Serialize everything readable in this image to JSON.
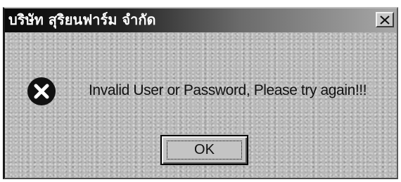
{
  "dialog": {
    "title": "บริษัท สุริยนฟาร์ม จำกัด",
    "message": "Invalid User or Password, Please try again!!!",
    "ok_label": "OK",
    "icon": "error-icon",
    "close_icon": "close-icon"
  },
  "colors": {
    "titlebar_start": "#0a0a0a",
    "titlebar_end": "#a8a8a8",
    "dialog_bg": "#b8b8b8",
    "error_icon_fill": "#111111"
  }
}
